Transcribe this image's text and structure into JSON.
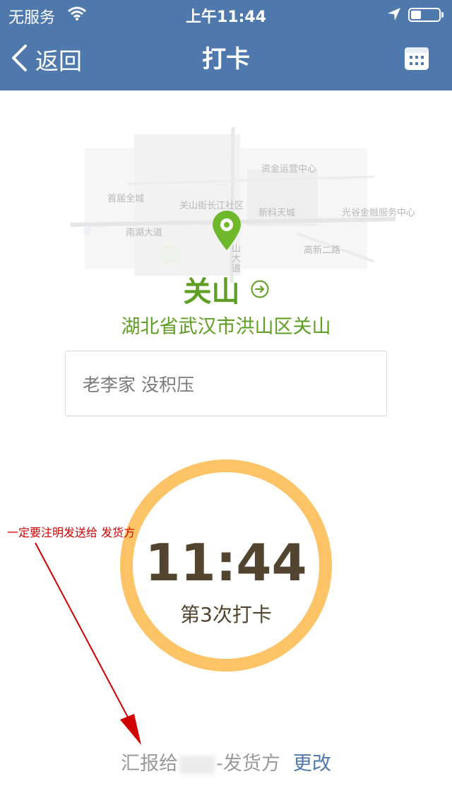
{
  "status_bar": {
    "carrier": "无服务",
    "time": "上午11:44"
  },
  "nav": {
    "back_label": "返回",
    "title": "打卡"
  },
  "map": {
    "labels": [
      "资金运营中心",
      "首届全城",
      "关山街长江社区",
      "新科天城",
      "光谷金融服务中心",
      "南湖大道",
      "高新二路",
      "山大道"
    ]
  },
  "location": {
    "name": "关山",
    "address": "湖北省武汉市洪山区关山"
  },
  "note": {
    "text": "老李家 没积压"
  },
  "clock": {
    "time": "11:44",
    "count_label": "第3次打卡"
  },
  "annotation": {
    "text": "一定要注明发送给 发货方"
  },
  "footer": {
    "report_prefix": "汇报给",
    "report_suffix": "-发货方",
    "edit_label": "更改"
  },
  "colors": {
    "nav_bg": "#4f79ad",
    "accent_green": "#5e9e22",
    "ring": "#fcc466",
    "annotation_red": "#d10000"
  }
}
